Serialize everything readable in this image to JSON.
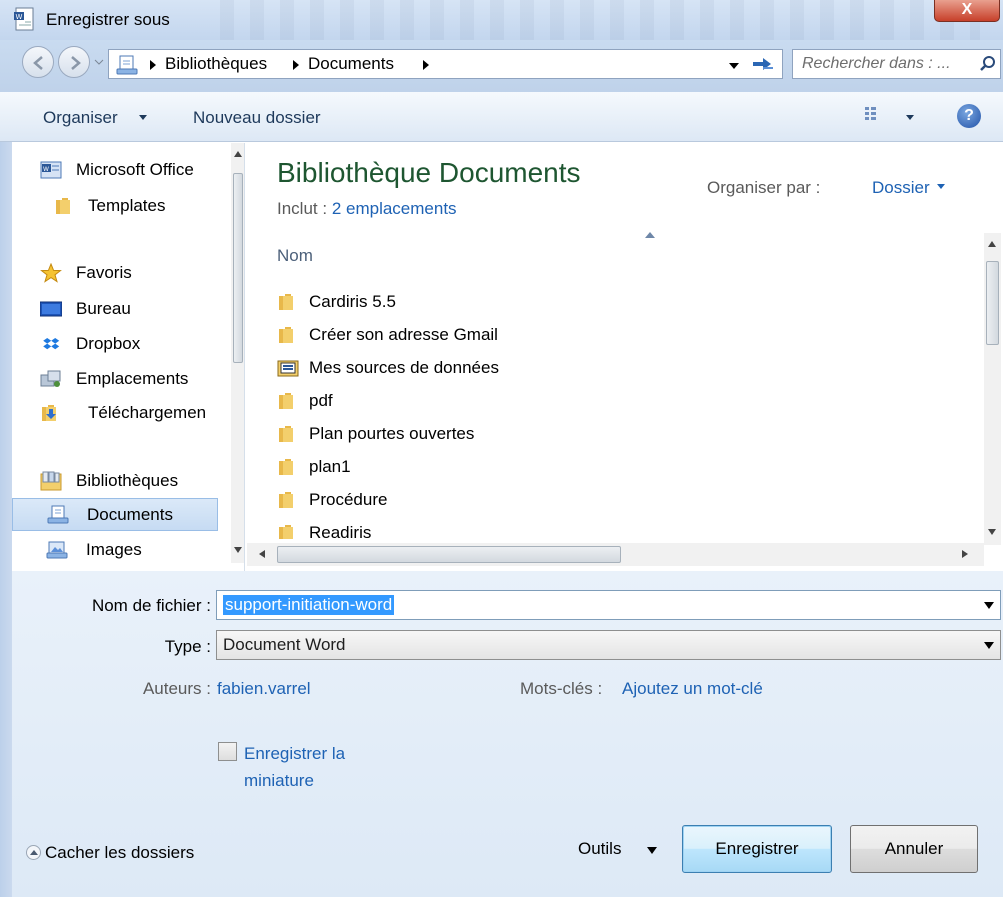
{
  "window": {
    "title": "Enregistrer sous",
    "close_label": "X"
  },
  "address": {
    "crumbs": [
      "Bibliothèques",
      "Documents"
    ],
    "search_placeholder": "Rechercher dans : ..."
  },
  "commands": {
    "organize": "Organiser",
    "new_folder": "Nouveau dossier"
  },
  "nav": {
    "items": [
      {
        "label": "Microsoft Office",
        "icon": "office-icon"
      },
      {
        "label": "Templates",
        "icon": "folder-icon"
      },
      {
        "label": "Favoris",
        "icon": "star-icon"
      },
      {
        "label": "Bureau",
        "icon": "desktop-icon"
      },
      {
        "label": "Dropbox",
        "icon": "dropbox-icon"
      },
      {
        "label": "Emplacements",
        "icon": "places-icon"
      },
      {
        "label": "Téléchargemen",
        "icon": "downloads-icon"
      },
      {
        "label": "Bibliothèques",
        "icon": "libraries-icon"
      },
      {
        "label": "Documents",
        "icon": "documents-icon",
        "selected": true
      },
      {
        "label": "Images",
        "icon": "images-icon"
      }
    ]
  },
  "content": {
    "title": "Bibliothèque Documents",
    "includes_prefix": "Inclut :",
    "includes_link": "2 emplacements",
    "arrange_label": "Organiser par :",
    "arrange_value": "Dossier",
    "column_name": "Nom",
    "files": [
      {
        "name": "Cardiris 5.5",
        "icon": "folder-icon"
      },
      {
        "name": "Créer son adresse Gmail",
        "icon": "folder-icon"
      },
      {
        "name": "Mes sources de données",
        "icon": "data-sources-folder-icon"
      },
      {
        "name": "pdf",
        "icon": "folder-icon"
      },
      {
        "name": "Plan pourtes ouvertes",
        "icon": "folder-icon"
      },
      {
        "name": "plan1",
        "icon": "folder-icon"
      },
      {
        "name": "Procédure",
        "icon": "folder-icon"
      },
      {
        "name": "Readiris",
        "icon": "folder-icon"
      }
    ]
  },
  "form": {
    "filename_label": "Nom de fichier :",
    "filename_value": "support-initiation-word",
    "type_label": "Type :",
    "type_value": "Document Word",
    "authors_label": "Auteurs :",
    "authors_value": "fabien.varrel",
    "keywords_label": "Mots-clés :",
    "keywords_value": "Ajoutez un mot-clé",
    "thumbnail_label": "Enregistrer la miniature"
  },
  "footer": {
    "hide_folders": "Cacher les dossiers",
    "tools": "Outils",
    "save": "Enregistrer",
    "cancel": "Annuler"
  },
  "colors": {
    "library_title": "#1e5631",
    "link": "#1e62b4",
    "selection": "#3399ff"
  }
}
